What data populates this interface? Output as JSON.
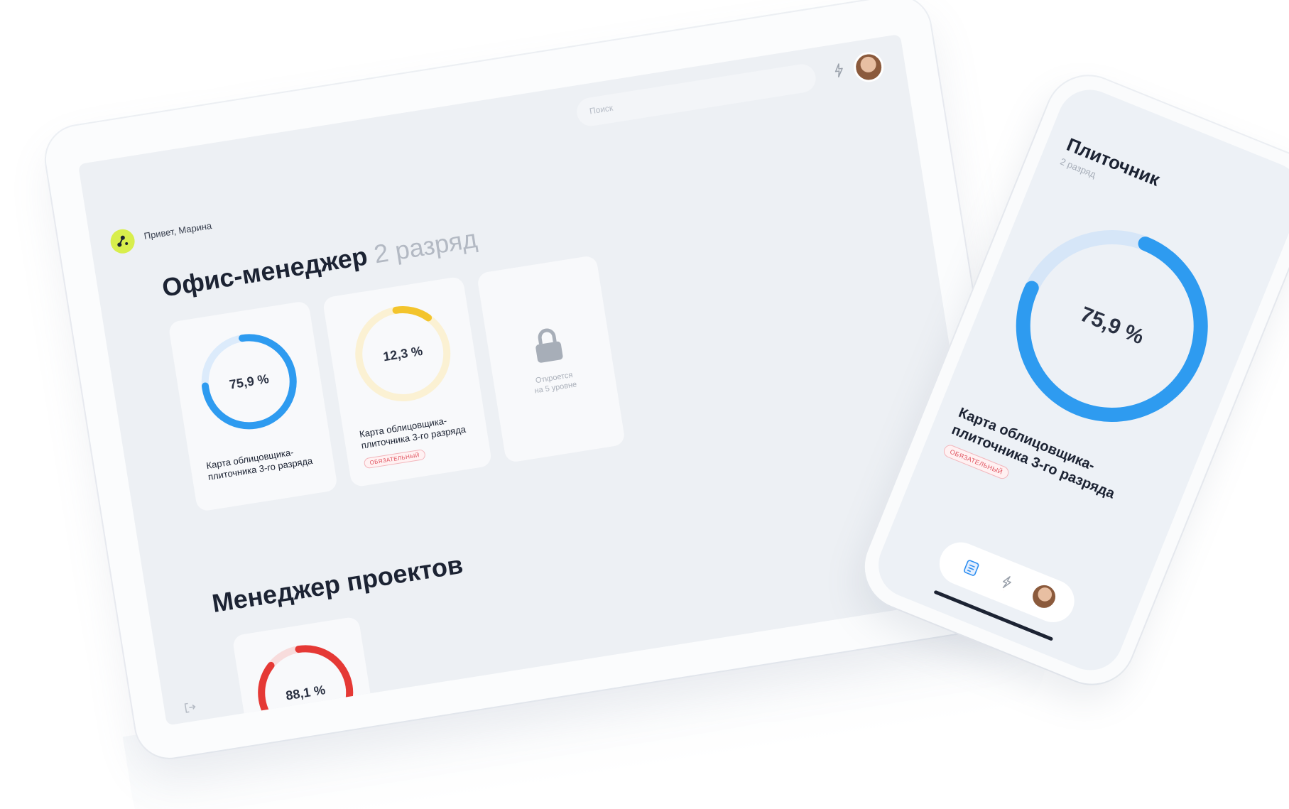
{
  "header": {
    "greeting": "Привет, Марина",
    "search_placeholder": "Поиск"
  },
  "office": {
    "title": "Офис-менеджер",
    "grade": "2 разряд",
    "cards": [
      {
        "value": "75,9 %",
        "progress": 0.759,
        "label": "Карта облицовщика-плиточника 3-го разряда",
        "color": "#2e9bf0",
        "track": "#dcebfb"
      },
      {
        "value": "12,3 %",
        "progress": 0.123,
        "label": "Карта облицовщика-плиточника 3-го разряда",
        "badge": "ОБЯЗАТЕЛЬНЫЙ",
        "color": "#f3c42c",
        "track": "#fbf1d3"
      }
    ],
    "locked": {
      "text_line1": "Откроется",
      "text_line2": "на 5 уровне"
    }
  },
  "projects": {
    "title": "Менеджер проектов",
    "card": {
      "value": "88,1 %",
      "progress": 0.881,
      "color": "#e53935",
      "track": "#f8dcdc"
    }
  },
  "phone": {
    "title": "Плиточник",
    "grade": "2 разряд",
    "value": "75,9 %",
    "progress": 0.759,
    "label": "Карта облицовщика-плиточника 3-го разряда",
    "badge": "ОБЯЗАТЕЛЬНЫЙ",
    "color": "#2e9bf0",
    "track": "#d6e6f8"
  },
  "colors": {
    "accent_logo": "#d8ee4c",
    "text_dark": "#1c2333",
    "badge_red": "#e0525e"
  },
  "icons": [
    "logo-icon",
    "bell-icon",
    "lock-icon",
    "logout-icon",
    "document-icon"
  ]
}
